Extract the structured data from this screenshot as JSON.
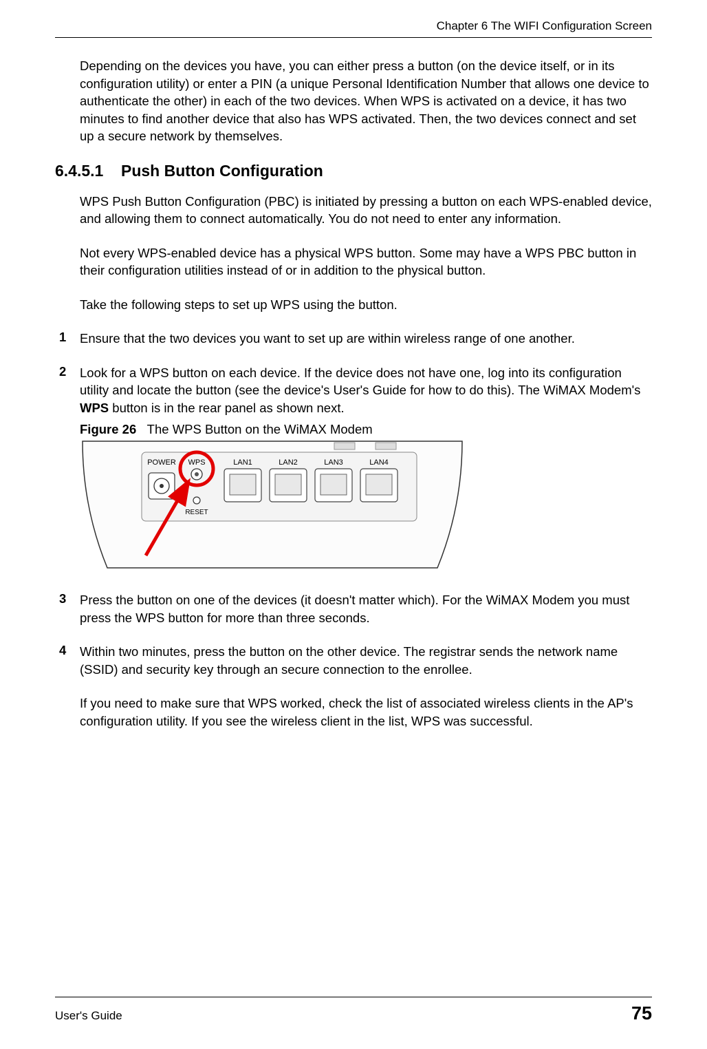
{
  "header": {
    "chapter": "Chapter 6 The WIFI Configuration Screen"
  },
  "intro_para": "Depending on the devices you have, you can either press a button (on the device itself, or in its configuration utility) or enter a PIN (a unique Personal Identification Number that allows one device to authenticate the other) in each of the two devices. When WPS is activated on a device, it has two minutes to find another device that also has WPS activated. Then, the two devices connect and set up a secure network by themselves.",
  "section": {
    "number": "6.4.5.1",
    "title": "Push Button Configuration"
  },
  "para2": "WPS Push Button Configuration (PBC) is initiated by pressing a button on each WPS-enabled device, and allowing them to connect automatically. You do not need to enter any information.",
  "para3": "Not every WPS-enabled device has a physical WPS button. Some may have a WPS PBC button in their configuration utilities instead of or in addition to the physical button.",
  "para4": "Take the following steps to set up WPS using the button.",
  "steps": [
    {
      "num": "1",
      "text": "Ensure that the two devices you want to set up are within wireless range of one another."
    },
    {
      "num": "2",
      "text_before": "Look for a WPS button on each device. If the device does not have one, log into its configuration utility and locate the button (see the device's User's Guide for how to do this). The WiMAX Modem's ",
      "bold": "WPS",
      "text_after": " button is in the rear panel as shown next."
    },
    {
      "num": "3",
      "text": "Press the button on one of the devices (it doesn't matter which). For the WiMAX Modem you must press the WPS button for more than three seconds."
    },
    {
      "num": "4",
      "text": "Within two minutes, press the button on the other device. The registrar sends the network name (SSID) and security key through an secure connection to the enrollee."
    }
  ],
  "figure": {
    "label": "Figure 26",
    "caption": "The WPS Button on the WiMAX Modem",
    "labels": {
      "power": "POWER",
      "wps": "WPS",
      "reset": "RESET",
      "lan1": "LAN1",
      "lan2": "LAN2",
      "lan3": "LAN3",
      "lan4": "LAN4"
    }
  },
  "closing": "If you need to make sure that WPS worked, check the list of associated wireless clients in the AP's configuration utility. If you see the wireless client in the list, WPS was successful.",
  "footer": {
    "left": "User's Guide",
    "page": "75"
  }
}
